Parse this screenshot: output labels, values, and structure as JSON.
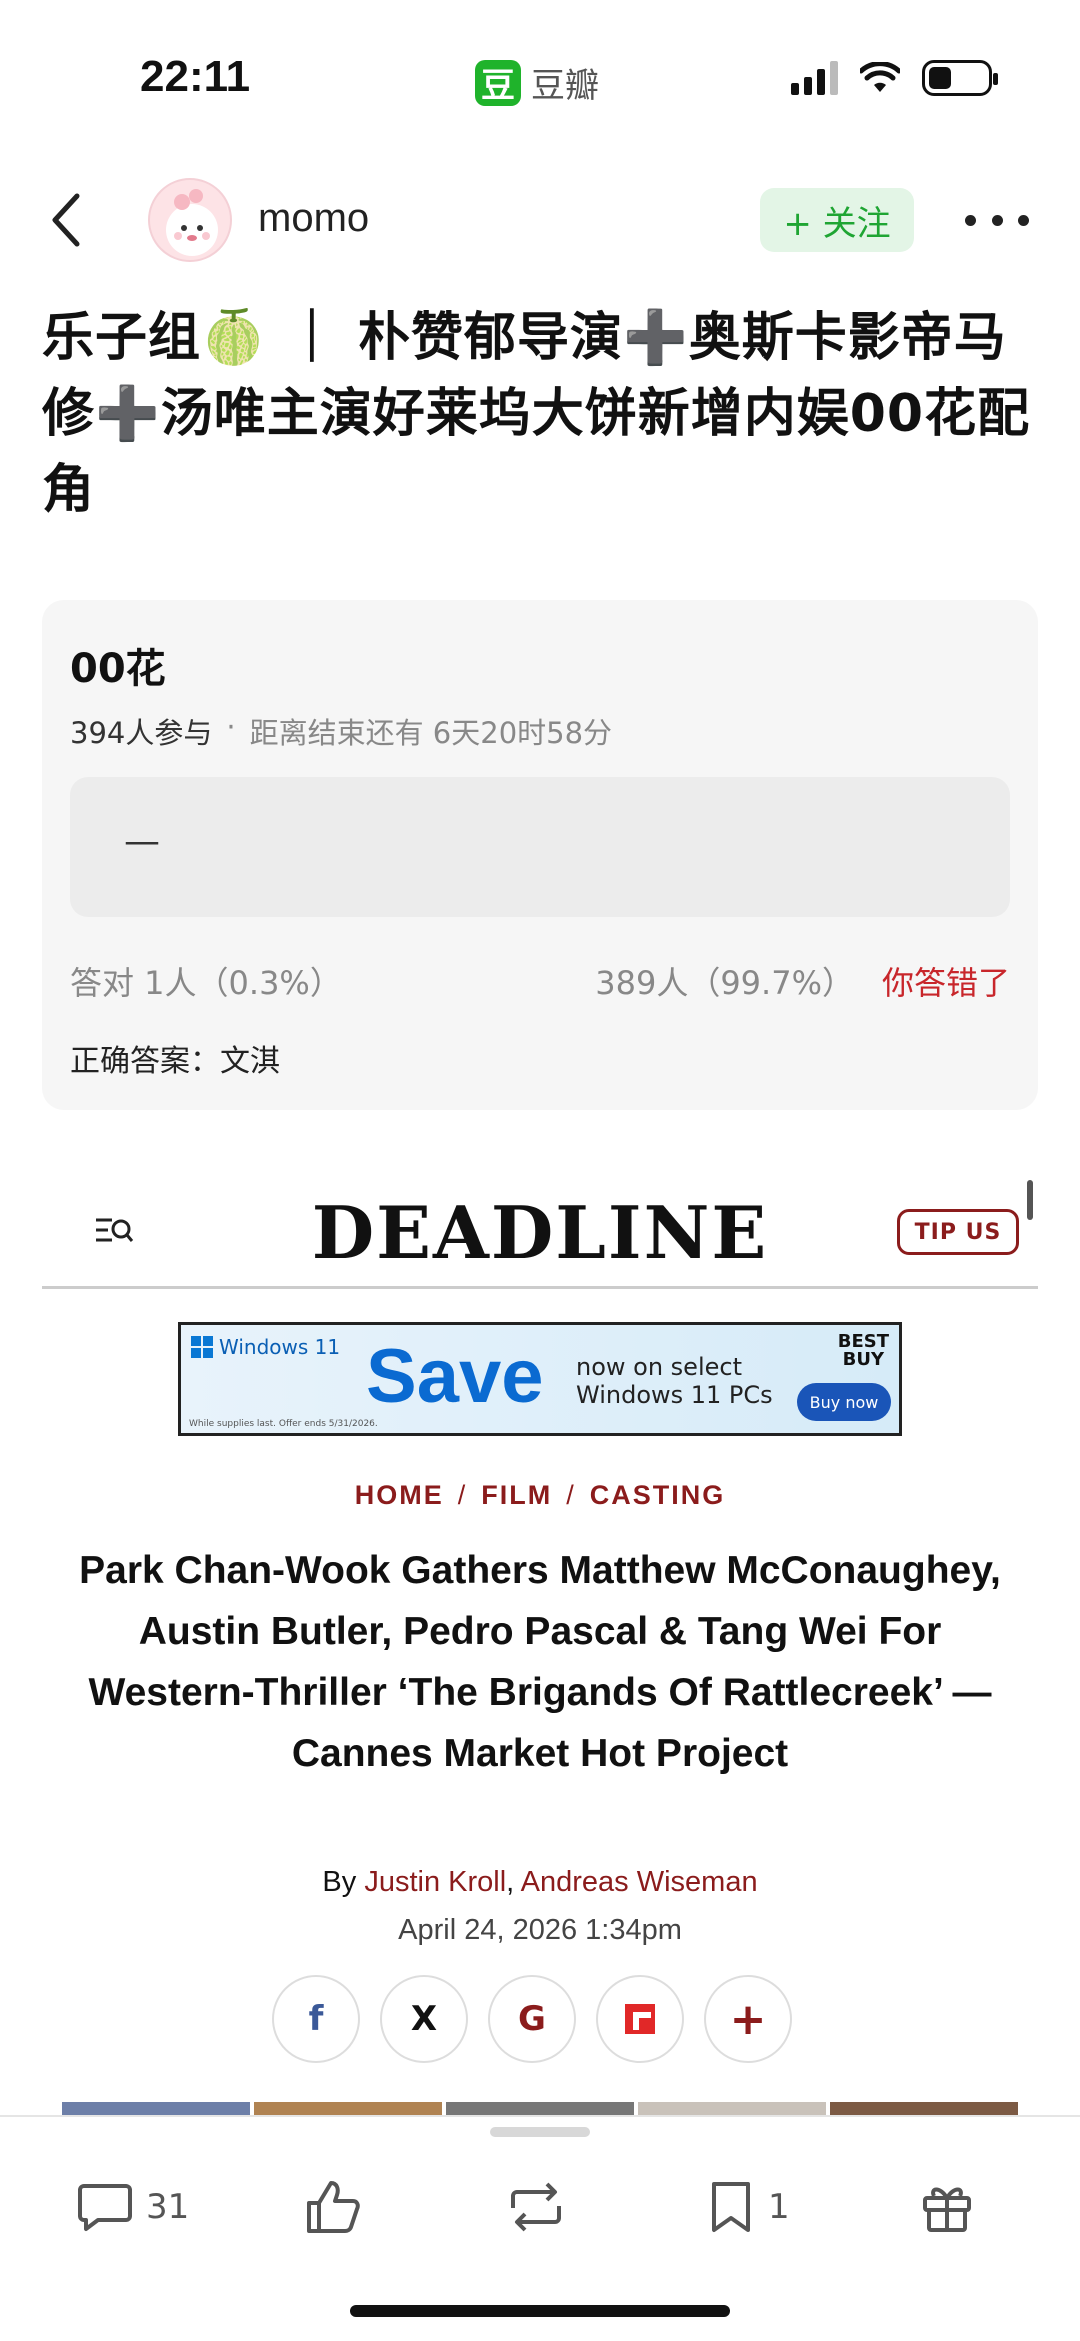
{
  "status_bar": {
    "time": "22:11",
    "app_icon_char": "豆",
    "app_name": "豆瓣",
    "battery_level": 0.4
  },
  "header": {
    "username": "momo",
    "follow_label": "+ 关注",
    "back_icon": "chevron-left-icon",
    "more_icon": "more-dots-icon"
  },
  "post": {
    "title": "乐子组🍈 ｜ 朴赞郁导演➕奥斯卡影帝马修➕汤唯主演好莱坞大饼新增内娱00花配角"
  },
  "poll": {
    "title": "00花",
    "participants": "394人参与",
    "separator": "·",
    "deadline": "距离结束还有 6天20时58分",
    "option_text": "—",
    "correct_stat": "答对  1人（0.3%）",
    "wrong_stat": "389人（99.7%）",
    "wrong_label": "你答错了",
    "answer": "正确答案：文淇"
  },
  "deadline": {
    "logo": "DEADLINE",
    "tip_label": "TIP US",
    "ad": {
      "brand": "Windows 11",
      "save": "Save",
      "copy_line1": "now on select",
      "copy_line2": "Windows 11 PCs",
      "retailer_line1": "BEST",
      "retailer_line2": "BUY",
      "cta": "Buy now",
      "fine_print": "While supplies last. Offer ends 5/31/2026."
    },
    "breadcrumb": [
      "HOME",
      "FILM",
      "CASTING"
    ],
    "breadcrumb_sep": "/",
    "headline": "Park Chan-Wook Gathers Matthew McConaughey, Austin Butler, Pedro Pascal & Tang Wei For Western-Thriller ‘The Brigands Of Rattlecreek’ — Cannes Market Hot Project",
    "byline_prefix": "By ",
    "author1": "Justin Kroll",
    "byline_sep": ", ",
    "author2": "Andreas Wiseman",
    "date": "April 24, 2026 1:34pm",
    "share": {
      "facebook": "f",
      "x": "X",
      "google": "G",
      "flipboard": "",
      "more": "+"
    },
    "colors": {
      "accent": "#8b1c1c"
    }
  },
  "actions": {
    "comments": "31",
    "likes": "",
    "reposts": "",
    "collects": "1"
  },
  "colors": {
    "brand_green": "#1fb32b",
    "follow_bg": "#e3f5e6",
    "wrong_red": "#c8262b"
  }
}
